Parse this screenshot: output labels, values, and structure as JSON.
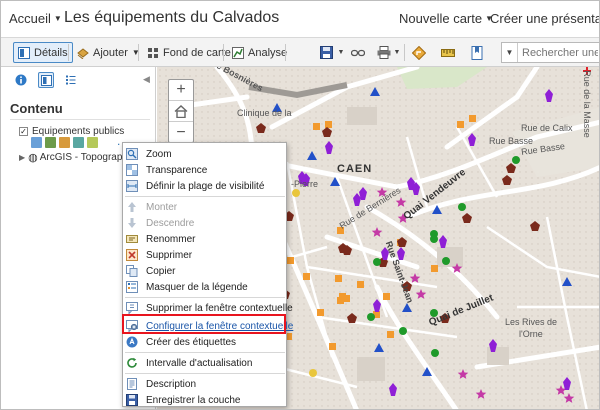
{
  "header": {
    "home_menu": "Accueil",
    "title": "Les équipements du Calvados",
    "new_map": "Nouvelle carte",
    "create_presentation": "Créer une présentation"
  },
  "toolbar": {
    "details": "Détails",
    "add": "Ajouter",
    "basemap": "Fond de carte",
    "analysis": "Analyse",
    "search_placeholder": "Rechercher une adre"
  },
  "panel": {
    "heading": "Contenu",
    "layers": [
      {
        "name": "Equipements publics",
        "checked": true
      },
      {
        "name": "ArcGIS - Topographic",
        "checked": false
      }
    ],
    "more": "..."
  },
  "map": {
    "labels": {
      "rue_bosnieres": "Rue Bosnières",
      "clinique": "Clinique de la",
      "caen": "CAEN",
      "rue_calix": "Rue de Calix",
      "rue_masse": "Rue de la Masse",
      "rue_basse_1": "Rue Basse",
      "rue_basse_2": "Rue Basse",
      "pierre": "-Pierre",
      "quai_vendeuvre": "Quai Vendeuvre",
      "rue_bernieres": "Rue de Bernières",
      "rue_st_jean": "Rue Saint-Jean",
      "quai_juillet": "Quai de Juillet",
      "rives_1": "Les Rives de",
      "rives_2": "l'Orne"
    },
    "colors": {
      "polygon": "#8f1fd6",
      "square": "#f29a2e",
      "pentagon": "#7a2a1c",
      "circle": "#1f9a2a",
      "triangle": "#2250c8",
      "star": "#c43aa6",
      "background": "#ede9e3"
    }
  },
  "context_menu": {
    "items": [
      {
        "label": "Zoom",
        "icon": "zoom-icon",
        "enabled": true
      },
      {
        "label": "Transparence",
        "icon": "transparency-icon",
        "enabled": true
      },
      {
        "label": "Définir la plage de visibilité",
        "icon": "visibility-range-icon",
        "enabled": true
      },
      {
        "label": "Monter",
        "icon": "move-up-icon",
        "enabled": false
      },
      {
        "label": "Descendre",
        "icon": "move-down-icon",
        "enabled": false
      },
      {
        "label": "Renommer",
        "icon": "rename-icon",
        "enabled": true
      },
      {
        "label": "Supprimer",
        "icon": "delete-icon",
        "enabled": true
      },
      {
        "label": "Copier",
        "icon": "copy-icon",
        "enabled": true
      },
      {
        "label": "Masquer de la légende",
        "icon": "hide-legend-icon",
        "enabled": true
      },
      {
        "label": "Supprimer la fenêtre contextuelle",
        "icon": "remove-popup-icon",
        "enabled": true
      },
      {
        "label": "Configurer la fenêtre contextuelle",
        "icon": "configure-popup-icon",
        "enabled": true,
        "highlighted": true
      },
      {
        "label": "Créer des étiquettes",
        "icon": "labels-icon",
        "enabled": true
      },
      {
        "label": "Intervalle d'actualisation",
        "icon": "refresh-interval-icon",
        "enabled": true
      },
      {
        "label": "Description",
        "icon": "description-icon",
        "enabled": true
      },
      {
        "label": "Enregistrer la couche",
        "icon": "save-layer-icon",
        "enabled": true
      }
    ]
  }
}
